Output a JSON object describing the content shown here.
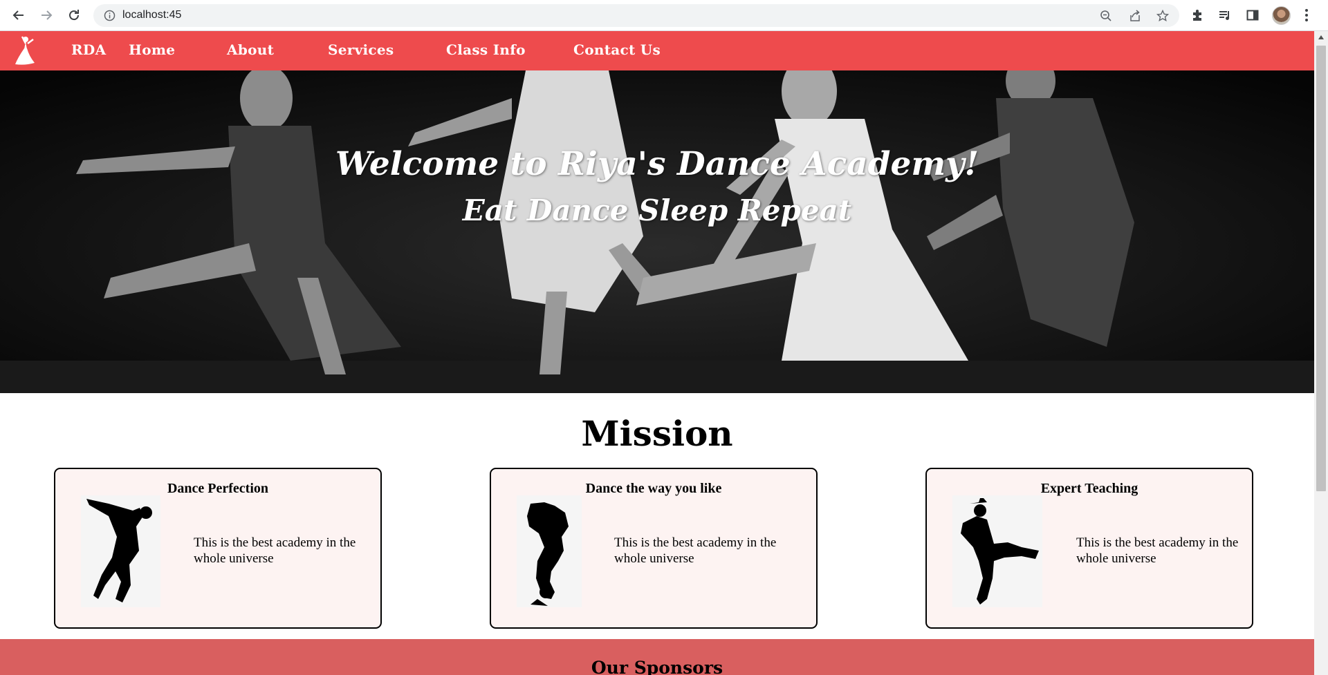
{
  "browser": {
    "url": "localhost:45",
    "icons": [
      "back-arrow-icon",
      "forward-arrow-icon",
      "reload-icon",
      "info-icon",
      "zoom-icon",
      "share-icon",
      "star-icon",
      "extensions-icon",
      "reading-list-icon",
      "side-panel-icon",
      "profile-avatar",
      "menu-kebab-icon"
    ]
  },
  "nav": {
    "brand": "RDA",
    "links": [
      "Home",
      "About",
      "Services",
      "Class Info",
      "Contact Us"
    ],
    "bg_color": "#ee4b4d"
  },
  "hero": {
    "title": "Welcome to Riya's Dance Academy!",
    "subtitle": "Eat Dance Sleep Repeat"
  },
  "mission": {
    "heading": "Mission",
    "cards": [
      {
        "title": "Dance Perfection",
        "text": "This is the best academy in the whole universe",
        "image": "breakdancer-silhouette"
      },
      {
        "title": "Dance the way you like",
        "text": "This is the best academy in the whole universe",
        "image": "handstand-dancer-silhouette"
      },
      {
        "title": "Expert Teaching",
        "text": "This is the best academy in the whole universe",
        "image": "hat-dancer-silhouette"
      }
    ]
  },
  "sponsors": {
    "heading": "Our Sponsors",
    "bg_color": "#d95f5f"
  }
}
